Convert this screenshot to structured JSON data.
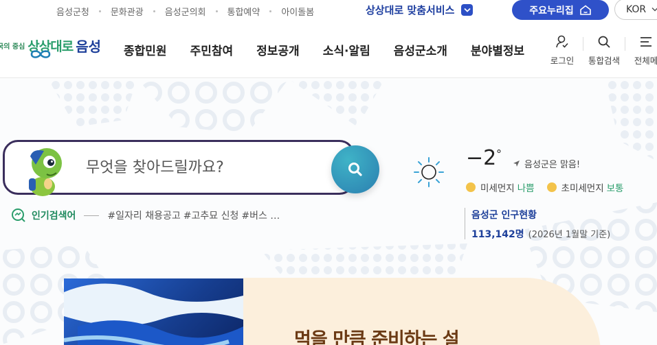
{
  "topbar": {
    "links": [
      "음성군청",
      "문화관광",
      "음성군의회",
      "통합예약",
      "아이돌봄"
    ],
    "custom_service": "상상대로 맞춤서비스",
    "main_button": "주요누리집",
    "language": "KOR"
  },
  "logo": {
    "subtitle": "국의 중심",
    "brand_a": "상상대로",
    "brand_b": "음성"
  },
  "nav": {
    "menu": [
      "종합민원",
      "주민참여",
      "정보공개",
      "소식·알림",
      "음성군소개",
      "분야별정보"
    ],
    "icons": [
      {
        "label": "로그인",
        "icon": "user-login-icon"
      },
      {
        "label": "통합검색",
        "icon": "search-icon"
      },
      {
        "label": "전체메",
        "icon": "menu-icon"
      }
    ]
  },
  "search": {
    "placeholder": "무엇을 찾아드릴까요?",
    "popular_label": "인기검색어",
    "popular_keywords": [
      "#일자리 채용공고",
      "#고추묘 신청",
      "#버스 …"
    ]
  },
  "weather": {
    "temperature": "−2",
    "degree": "°",
    "description": "음성군은 맑음!",
    "dust_label": "미세먼지",
    "dust_status": "나쁨",
    "fine_dust_label": "초미세먼지",
    "fine_dust_status": "보통",
    "colors": {
      "good": "#2a9d6b",
      "accent": "#1d3f9a"
    }
  },
  "population": {
    "title": "음성군 인구현황",
    "count": "113,142명",
    "basis": "(2026년 1월말 기준)"
  },
  "banner": {
    "text": "먹을 만큼 준비하는 설"
  }
}
